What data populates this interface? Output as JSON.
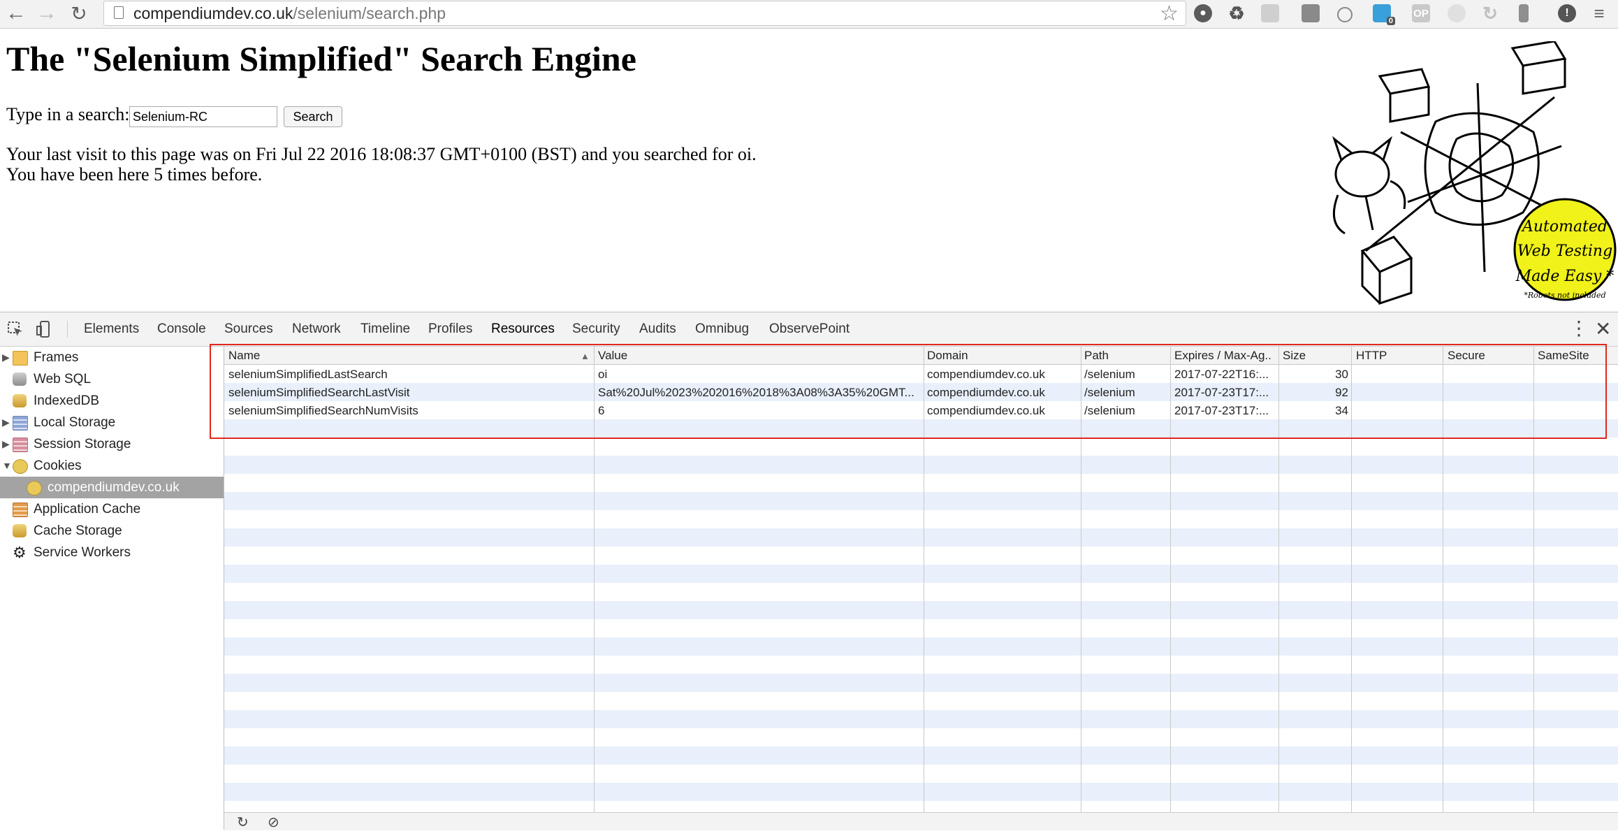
{
  "browser": {
    "url_host": "compendiumdev.co.uk",
    "url_path": "/selenium/search.php",
    "extension_badge": "0",
    "op_extension": "OP"
  },
  "page": {
    "title": "The \"Selenium Simplified\" Search Engine",
    "search_label": "Type in a search:",
    "search_value": "Selenium-RC",
    "search_button": "Search",
    "visit_text": "Your last visit to this page was on Fri Jul 22 2016 18:08:37 GMT+0100 (BST) and you searched for oi.",
    "visits_text": "You have been here 5 times before.",
    "logo_text": [
      "Automated",
      "Web Testing",
      "Made Easy *"
    ],
    "logo_footnote": "*Robots not included"
  },
  "devtools": {
    "tabs": [
      "Elements",
      "Console",
      "Sources",
      "Network",
      "Timeline",
      "Profiles",
      "Resources",
      "Security",
      "Audits",
      "Omnibug",
      "ObservePoint"
    ],
    "active_tab": "Resources",
    "sidebar": [
      {
        "label": "Frames",
        "icon": "folder-icon"
      },
      {
        "label": "Web SQL",
        "icon": "database-icon"
      },
      {
        "label": "IndexedDB",
        "icon": "database-icon"
      },
      {
        "label": "Local Storage",
        "icon": "table-icon"
      },
      {
        "label": "Session Storage",
        "icon": "table-icon"
      },
      {
        "label": "Cookies",
        "icon": "cookie-icon"
      },
      {
        "label": "compendiumdev.co.uk",
        "icon": "cookie-icon"
      },
      {
        "label": "Application Cache",
        "icon": "table-icon"
      },
      {
        "label": "Cache Storage",
        "icon": "database-icon"
      },
      {
        "label": "Service Workers",
        "icon": "gear-icon"
      }
    ],
    "cookie_columns": [
      "Name",
      "Value",
      "Domain",
      "Path",
      "Expires / Max-Ag..",
      "Size",
      "HTTP",
      "Secure",
      "SameSite"
    ],
    "cookies": [
      {
        "name": "seleniumSimplifiedLastSearch",
        "value": "oi",
        "domain": "compendiumdev.co.uk",
        "path": "/selenium",
        "expires": "2017-07-22T16:...",
        "size": "30",
        "http": "",
        "secure": "",
        "samesite": ""
      },
      {
        "name": "seleniumSimplifiedSearchLastVisit",
        "value": "Sat%20Jul%2023%202016%2018%3A08%3A35%20GMT...",
        "domain": "compendiumdev.co.uk",
        "path": "/selenium",
        "expires": "2017-07-23T17:...",
        "size": "92",
        "http": "",
        "secure": "",
        "samesite": ""
      },
      {
        "name": "seleniumSimplifiedSearchNumVisits",
        "value": "6",
        "domain": "compendiumdev.co.uk",
        "path": "/selenium",
        "expires": "2017-07-23T17:...",
        "size": "34",
        "http": "",
        "secure": "",
        "samesite": ""
      }
    ],
    "colors": {
      "highlight": "#e0271f",
      "row_stripe": "#e9f0fb",
      "selected": "#a3a3a3"
    }
  }
}
